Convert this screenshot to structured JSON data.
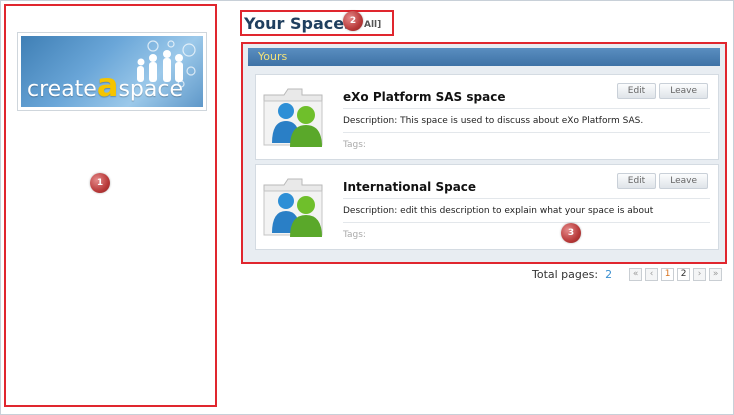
{
  "header": {
    "title": "Your Spaces",
    "all_link": "All]"
  },
  "logo": {
    "text_create": "create",
    "text_a": "a",
    "text_space": "space"
  },
  "markers": {
    "m1": "1",
    "m2": "2",
    "m3": "3"
  },
  "spaces": {
    "section_title": "Yours",
    "items": [
      {
        "name": "eXo Platform SAS space",
        "description": "Description: This space is used to discuss about eXo Platform SAS.",
        "tags": "Tags:",
        "edit_label": "Edit",
        "leave_label": "Leave"
      },
      {
        "name": "International Space",
        "description": "Description: edit this description to explain what your space is about",
        "tags": "Tags:",
        "edit_label": "Edit",
        "leave_label": "Leave"
      }
    ]
  },
  "pagination": {
    "total_label": "Total pages:",
    "total_pages": "2",
    "first_icon": "double-left-arrow",
    "prev_icon": "left-arrow",
    "pages": [
      "1",
      "2"
    ],
    "current_page": "1",
    "next_icon": "right-arrow",
    "last_icon": "double-right-arrow"
  },
  "colors": {
    "highlight_border": "#e0262e",
    "section_header": "#3e72a6",
    "section_header_text": "#f3e27a",
    "title": "#1f3f5f",
    "page_active": "#d8731e"
  }
}
